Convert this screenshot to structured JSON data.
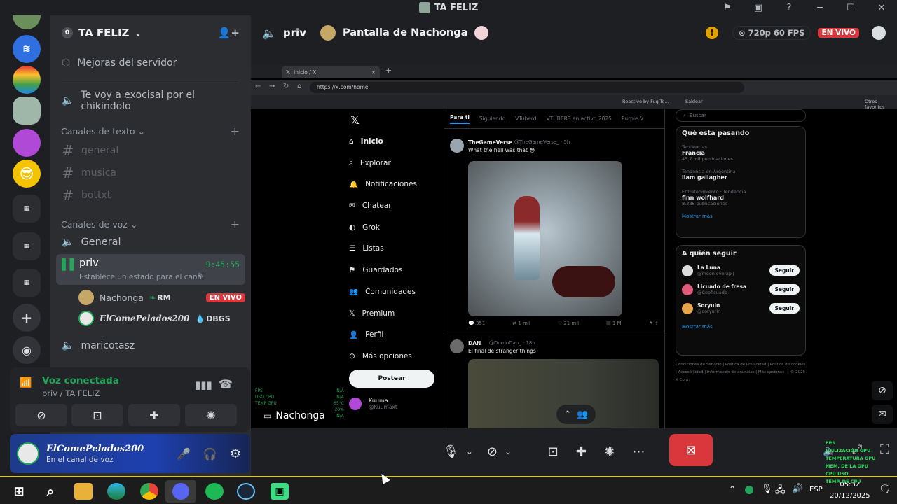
{
  "window": {
    "title": "TA FELIZ"
  },
  "server": {
    "name": "TA FELIZ",
    "boost_item": "Mejoras del servidor"
  },
  "sidebar": {
    "announcement_channel": "Te voy a exocisal por el chikindolo",
    "text_category": "Canales de texto",
    "text_channels": [
      "general",
      "musica",
      "bottxt"
    ],
    "voice_category": "Canales de voz",
    "voice_channels": {
      "general": "General",
      "priv": {
        "name": "priv",
        "timer": "9:45:55",
        "status_hint": "Establece un estado para el canal"
      },
      "members": [
        {
          "name": "Nachonga",
          "tag": "RM",
          "badge": "EN VIVO"
        },
        {
          "name": "ElComePelados200",
          "tag": "DBGS"
        }
      ],
      "other": "maricotasz"
    }
  },
  "voice_panel": {
    "status": "Voz conectada",
    "location": "priv / TA FELIZ"
  },
  "user": {
    "name": "ElComePelados200",
    "status": "En el canal de voz"
  },
  "stage": {
    "channel": "priv",
    "stream_title": "Pantalla de Nachonga",
    "quality": "720p 60 FPS",
    "live_badge": "EN VIVO",
    "streamer_label": "Nachonga"
  },
  "browser": {
    "tab_title": "Inicio / X",
    "url": "https://x.com/home",
    "bookmark_items": [
      "Reactive by FugiTe...",
      "Saldoar",
      "Otros favoritos"
    ],
    "search_placeholder": "Buscar",
    "x_nav": [
      "Inicio",
      "Explorar",
      "Notificaciones",
      "Chatear",
      "Grok",
      "Listas",
      "Guardados",
      "Comunidades",
      "Premium",
      "Perfil",
      "Más opciones"
    ],
    "post_button": "Postear",
    "account_name": "Kuuma",
    "account_handle": "@Kuumaxt",
    "feed_tabs": [
      "Para ti",
      "Siguiendo",
      "VTuberd",
      "VTUBERS en activo 2025",
      "Purple V"
    ],
    "tweets": [
      {
        "author": "TheGameVerse",
        "handle": "@TheGameVerse_ · 5h",
        "text": "What the hell was that 😳",
        "stats": [
          "351",
          "1 mil",
          "21 mil",
          "1 M"
        ]
      },
      {
        "author": "DAN",
        "handle": "@DordoDan_ · 18h",
        "text": "El final de stranger things"
      }
    ],
    "trending": {
      "title": "Qué está pasando",
      "items": [
        {
          "context": "Tendencias",
          "name": "Francia",
          "count": "45,7 mil publicaciones"
        },
        {
          "context": "Tendencia en Argentina",
          "name": "liam gallagher",
          "count": ""
        },
        {
          "context": "Entretenimiento · Tendencia",
          "name": "finn wolfhard",
          "count": "8.336 publicaciones"
        }
      ],
      "show_more": "Mostrar más"
    },
    "who_to_follow": {
      "title": "A quién seguir",
      "people": [
        {
          "name": "La Luna",
          "handle": "@moonloverxjxj"
        },
        {
          "name": "Licuado de fresa",
          "handle": "@Ceoficuado"
        },
        {
          "name": "Soryuin",
          "handle": "@coryurin"
        }
      ],
      "follow_label": "Seguir",
      "show_more": "Mostrar más"
    },
    "footer": "Condiciones de Servicio | Política de Privacidad | Política de cookies | Accesibilidad | Información de anuncios | Más opciones ··· © 2025 X Corp.",
    "overlay_labels": [
      "FPS",
      "USO CPU",
      "TEMP GPU"
    ],
    "overlay_values": [
      "N/A",
      "N/A",
      "65°C",
      "20%",
      "N/A"
    ]
  },
  "taskbar": {
    "lang": "ESP",
    "time": "05:32",
    "date": "20/12/2025",
    "overlay_lines": [
      "FPS",
      "UTILIZACIÓN GPU",
      "TEMPERATURA GPU",
      "MEM. DE LA GPU",
      "CPU USO",
      "TEMP. DE CPU"
    ]
  },
  "colors": {
    "accent_live": "#da373c",
    "green": "#23a55a",
    "blurple": "#5865f2",
    "end_call": "#da373c"
  }
}
